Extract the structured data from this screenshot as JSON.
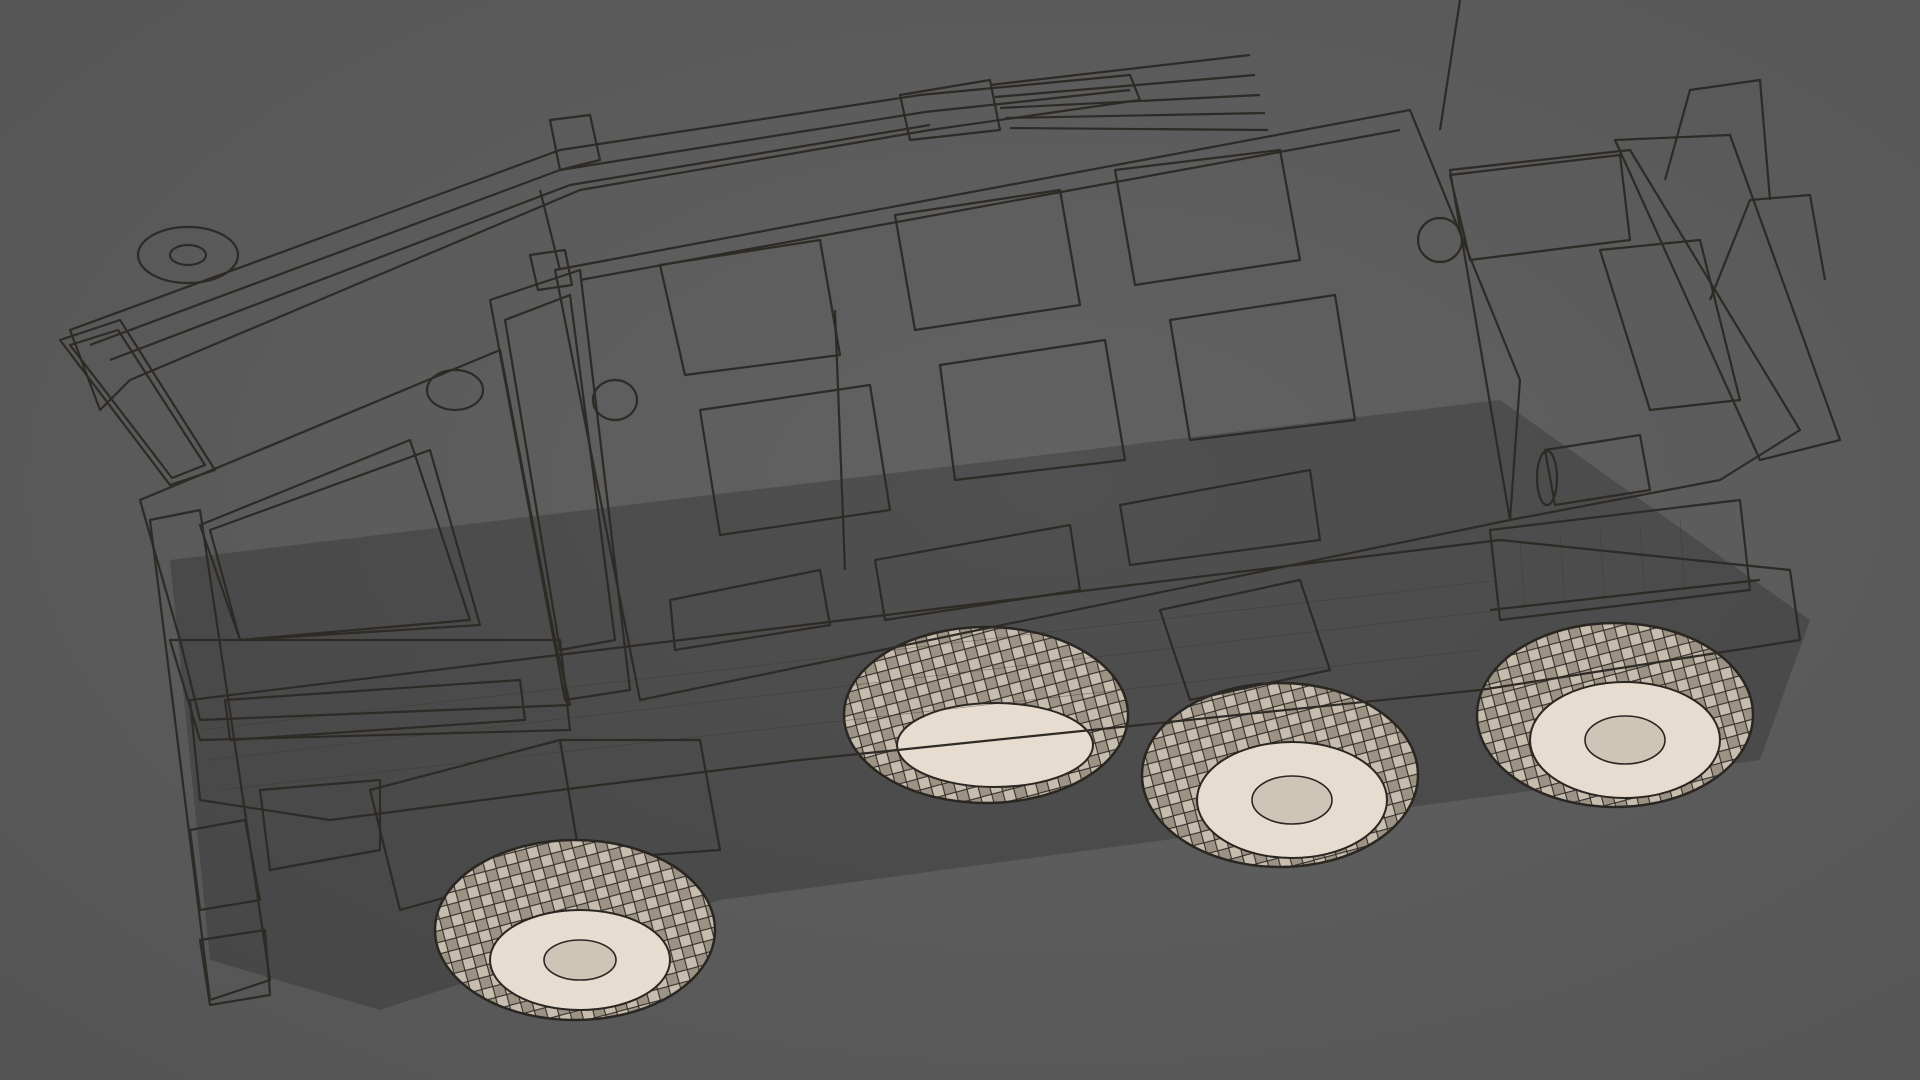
{
  "scene": {
    "subject": "armored-6x6-vehicle-wireframe-render",
    "background_color": "#5b5b5b",
    "model_base_color": "#ece4d8",
    "wire_color": "#2e2a25"
  }
}
